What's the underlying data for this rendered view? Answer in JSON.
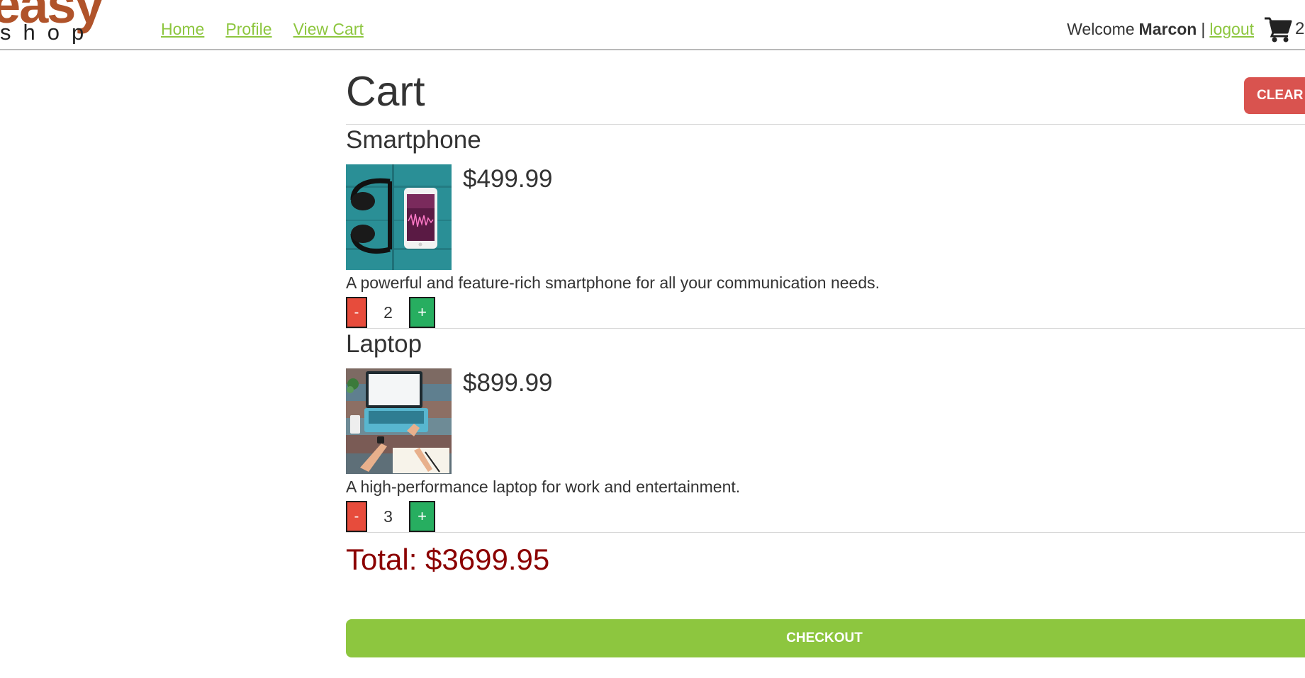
{
  "header": {
    "logo_big": "easy",
    "logo_small": "shop",
    "nav": [
      {
        "label": "Home"
      },
      {
        "label": "Profile"
      },
      {
        "label": "View Cart"
      }
    ],
    "welcome_label": "Welcome",
    "username": "Marcon",
    "separator": "|",
    "logout_label": "logout",
    "cart_icon": "shopping-cart-icon",
    "cart_count": "2"
  },
  "cart": {
    "title": "Cart",
    "clear_label": "CLEAR",
    "items": [
      {
        "name": "Smartphone",
        "price": "$499.99",
        "description": "A powerful and feature-rich smartphone for all your communication needs.",
        "quantity": "2",
        "minus_label": "-",
        "plus_label": "+"
      },
      {
        "name": "Laptop",
        "price": "$899.99",
        "description": "A high-performance laptop for work and entertainment.",
        "quantity": "3",
        "minus_label": "-",
        "plus_label": "+"
      }
    ],
    "total": "Total: $3699.95",
    "checkout_label": "CHECKOUT"
  },
  "colors": {
    "accent_green": "#8dc63f",
    "danger_red": "#d9534f",
    "total_color": "#8b0000",
    "logo_brown": "#b0532a"
  }
}
